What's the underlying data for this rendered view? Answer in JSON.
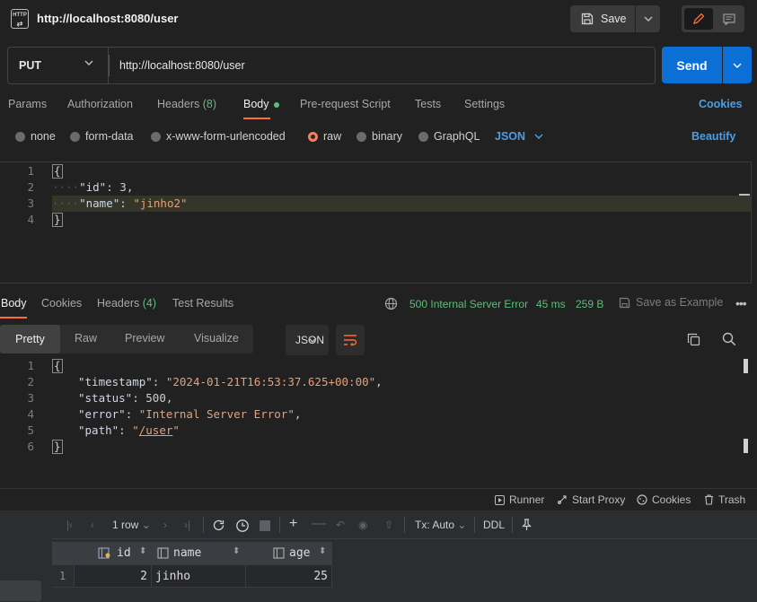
{
  "header": {
    "app_icon": "http-file-icon",
    "app_icon_text": "HTTP",
    "title": "http://localhost:8080/user",
    "save_label": "Save"
  },
  "request": {
    "method": "PUT",
    "url": "http://localhost:8080/user",
    "send_label": "Send"
  },
  "request_tabs": [
    {
      "label": "Params"
    },
    {
      "label": "Authorization"
    },
    {
      "label": "Headers",
      "count": "(8)"
    },
    {
      "label": "Body",
      "active": true
    },
    {
      "label": "Pre-request Script"
    },
    {
      "label": "Tests"
    },
    {
      "label": "Settings"
    }
  ],
  "cookies_label": "Cookies",
  "body_types": [
    "none",
    "form-data",
    "x-www-form-urlencoded",
    "raw",
    "binary",
    "GraphQL"
  ],
  "body_type_selected": "raw",
  "body_format": "JSON",
  "beautify_label": "Beautify",
  "request_body": {
    "line_numbers": [
      "1",
      "2",
      "3",
      "4"
    ],
    "lines": [
      "{",
      "    \"id\": 3,",
      "    \"name\": \"jinho2\"",
      "}"
    ],
    "id_key": "\"id\"",
    "id_value": "3",
    "name_key": "\"name\"",
    "name_value": "\"jinho2\""
  },
  "response_tabs": [
    {
      "label": "Body",
      "active": true
    },
    {
      "label": "Cookies"
    },
    {
      "label": "Headers",
      "count": "(4)"
    },
    {
      "label": "Test Results"
    }
  ],
  "response_status": {
    "status": "500 Internal Server Error",
    "time": "45 ms",
    "size": "259 B",
    "save_example": "Save as Example",
    "status_color": "#5bbf7a"
  },
  "view_tabs": [
    "Pretty",
    "Raw",
    "Preview",
    "Visualize"
  ],
  "response_format": "JSON",
  "response_body": {
    "line_numbers": [
      "1",
      "2",
      "3",
      "4",
      "5",
      "6"
    ],
    "timestamp_key": "\"timestamp\"",
    "timestamp_value": "\"2024-01-21T16:53:37.625+00:00\"",
    "status_key": "\"status\"",
    "status_value": "500",
    "error_key": "\"error\"",
    "error_value": "\"Internal Server Error\"",
    "path_key": "\"path\"",
    "path_value": "/user"
  },
  "statusbar": {
    "runner": "Runner",
    "start_proxy": "Start Proxy",
    "cookies": "Cookies",
    "trash": "Trash"
  },
  "db": {
    "row_count": "1 row",
    "tx_mode": "Tx: Auto",
    "ddl_label": "DDL",
    "columns": [
      "id",
      "name",
      "age"
    ],
    "rows": [
      {
        "num": "1",
        "id": "2",
        "name": "jinho",
        "age": "25"
      }
    ]
  },
  "colors": {
    "accent_orange": "#ff6c37",
    "link_blue": "#4a9ee8",
    "send_blue": "#0b6fd6",
    "success_green": "#5bbf7a"
  }
}
